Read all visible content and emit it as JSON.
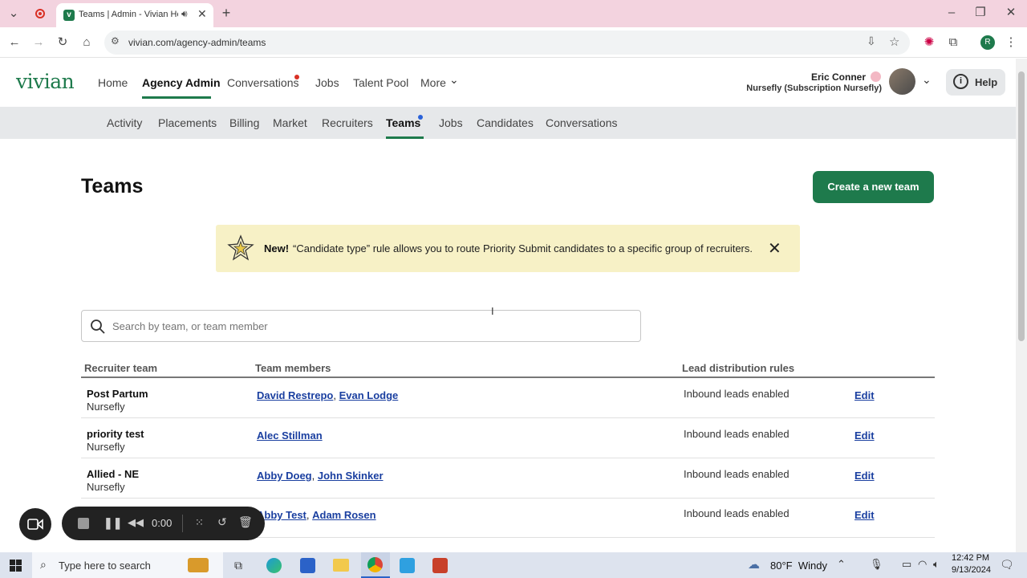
{
  "browser": {
    "tab_title": "Teams | Admin - Vivian Hea",
    "url": "vivian.com/agency-admin/teams",
    "profile_initial": "R"
  },
  "header": {
    "logo": "vivian",
    "nav": [
      {
        "label": "Home"
      },
      {
        "label": "Agency Admin"
      },
      {
        "label": "Conversations"
      },
      {
        "label": "Jobs"
      },
      {
        "label": "Talent Pool"
      },
      {
        "label": "More"
      }
    ],
    "user_name": "Eric Conner",
    "user_org": "Nursefly (Subscription Nursefly)",
    "help_label": "Help"
  },
  "subnav": [
    {
      "label": "Activity"
    },
    {
      "label": "Placements"
    },
    {
      "label": "Billing"
    },
    {
      "label": "Market"
    },
    {
      "label": "Recruiters"
    },
    {
      "label": "Teams"
    },
    {
      "label": "Jobs"
    },
    {
      "label": "Candidates"
    },
    {
      "label": "Conversations"
    }
  ],
  "page": {
    "title": "Teams",
    "create_button": "Create a new team",
    "banner_new": "New!",
    "banner_text": "“Candidate type” rule allows you to route Priority Submit candidates to a specific group of recruiters.",
    "search_placeholder": "Search by team, or team member"
  },
  "table": {
    "headers": [
      "Recruiter team",
      "Team members",
      "Lead distribution rules"
    ],
    "rows": [
      {
        "team": "Post Partum",
        "org": "Nursefly",
        "members": [
          "David Restrepo",
          "Evan Lodge"
        ],
        "rule": "Inbound leads enabled",
        "action": "Edit"
      },
      {
        "team": "priority test",
        "org": "Nursefly",
        "members": [
          "Alec Stillman"
        ],
        "rule": "Inbound leads enabled",
        "action": "Edit"
      },
      {
        "team": "Allied - NE",
        "org": "Nursefly",
        "members": [
          "Abby Doeg",
          "John Skinker"
        ],
        "rule": "Inbound leads enabled",
        "action": "Edit"
      },
      {
        "team": "",
        "org": "",
        "members": [
          "Abby Test",
          "Adam Rosen"
        ],
        "rule": "Inbound leads enabled",
        "action": "Edit"
      }
    ]
  },
  "recorder": {
    "time": "0:00"
  },
  "taskbar": {
    "search_placeholder": "Type here to search",
    "weather": "80°F  Windy",
    "time": "12:42 PM",
    "date": "9/13/2024"
  },
  "colors": {
    "brand_green": "#1e7a4c",
    "link_blue": "#1a3fa0",
    "banner_bg": "#f7f1c6",
    "tab_strip": "#f3d3df"
  }
}
